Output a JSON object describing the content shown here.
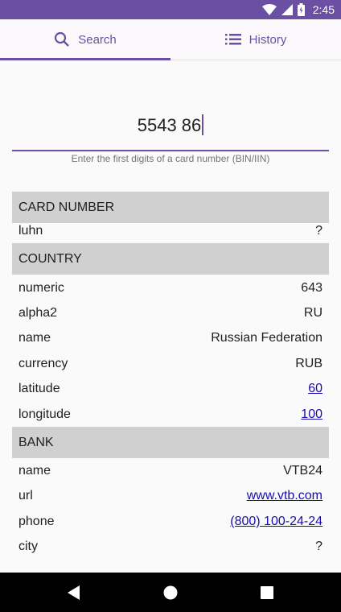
{
  "status_bar": {
    "time": "2:45",
    "icons": [
      "wifi-icon",
      "signal-icon",
      "battery-icon"
    ]
  },
  "tabs": [
    {
      "label": "Search",
      "icon": "search-icon",
      "active": true
    },
    {
      "label": "History",
      "icon": "list-icon",
      "active": false
    }
  ],
  "search": {
    "value": "5543 86",
    "hint": "Enter the first digits of a card number (BIN/IIN)"
  },
  "sections": {
    "card_number": {
      "title": "CARD NUMBER",
      "rows": [
        {
          "label": "luhn",
          "value": "?"
        }
      ]
    },
    "country": {
      "title": "COUNTRY",
      "rows": [
        {
          "label": "numeric",
          "value": "643"
        },
        {
          "label": "alpha2",
          "value": "RU"
        },
        {
          "label": "name",
          "value": "Russian Federation"
        },
        {
          "label": "currency",
          "value": "RUB"
        },
        {
          "label": "latitude",
          "value": "60"
        },
        {
          "label": "longitude",
          "value": "100"
        }
      ]
    },
    "bank": {
      "title": "BANK",
      "rows": [
        {
          "label": "name",
          "value": "VTB24"
        },
        {
          "label": "url",
          "value": "www.vtb.com"
        },
        {
          "label": "phone",
          "value": "(800) 100-24-24"
        },
        {
          "label": "city",
          "value": "?"
        }
      ]
    }
  },
  "colors": {
    "accent": "#6a4fa3",
    "section_bg": "#d0d0d0",
    "link": "#1a0dab"
  },
  "nav_bar": {
    "buttons": [
      "back-icon",
      "home-icon",
      "recents-icon"
    ]
  }
}
